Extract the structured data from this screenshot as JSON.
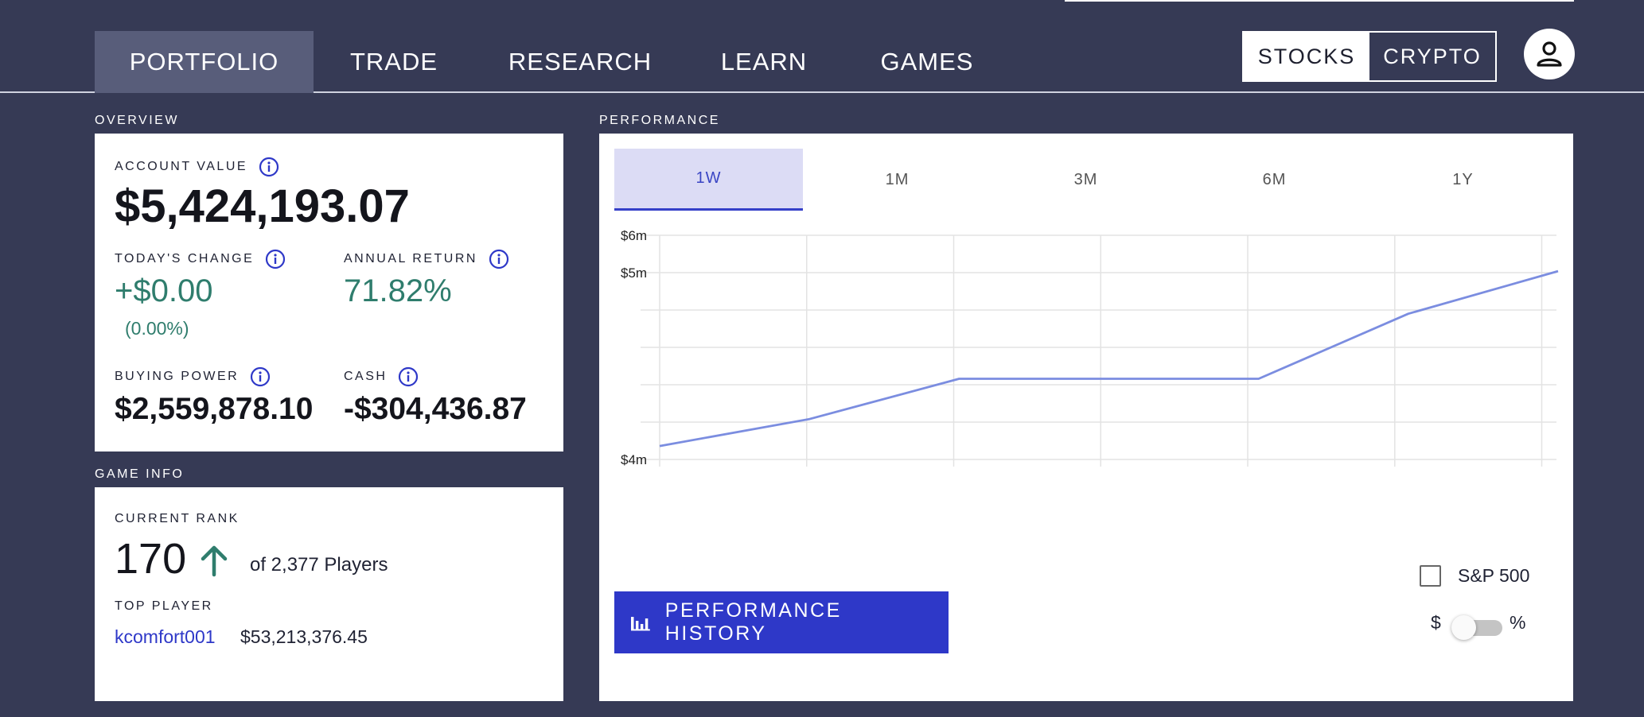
{
  "nav": {
    "tabs": [
      {
        "label": "PORTFOLIO",
        "active": true
      },
      {
        "label": "TRADE"
      },
      {
        "label": "RESEARCH"
      },
      {
        "label": "LEARN"
      },
      {
        "label": "GAMES"
      }
    ],
    "toggle": {
      "stocks": "STOCKS",
      "crypto": "CRYPTO",
      "selected": "STOCKS"
    },
    "avatar_icon": "user-icon"
  },
  "overview": {
    "section_label": "OVERVIEW",
    "account_value_label": "ACCOUNT VALUE",
    "account_value": "$5,424,193.07",
    "todays_change_label": "TODAY'S CHANGE",
    "todays_change": "+$0.00",
    "todays_change_pct": "(0.00%)",
    "annual_return_label": "ANNUAL RETURN",
    "annual_return": "71.82%",
    "buying_power_label": "BUYING POWER",
    "buying_power": "$2,559,878.10",
    "cash_label": "CASH",
    "cash": "-$304,436.87"
  },
  "game_info": {
    "section_label": "GAME INFO",
    "current_rank_label": "CURRENT RANK",
    "rank": "170",
    "rank_trend_icon": "arrow-up-icon",
    "players_text": "of 2,377 Players",
    "top_player_label": "TOP PLAYER",
    "top_player_name": "kcomfort001",
    "top_player_value": "$53,213,376.45"
  },
  "performance": {
    "section_label": "PERFORMANCE",
    "timeframes": [
      "1W",
      "1M",
      "3M",
      "6M",
      "1Y"
    ],
    "selected_timeframe": "1W",
    "history_button": "PERFORMANCE HISTORY",
    "sp500_label": "S&P 500",
    "sp500_checked": false,
    "unit_dollar": "$",
    "unit_percent": "%",
    "unit_selected": "$"
  },
  "colors": {
    "background": "#363a55",
    "accent": "#2e38c8",
    "positive": "#2f7d6d",
    "line": "#7b8de0"
  },
  "chart_data": {
    "type": "line",
    "y_tick_labels": [
      "$6m",
      "$5m",
      "$4m"
    ],
    "ylim": [
      4000000,
      6000000
    ],
    "x": [
      0,
      1,
      2,
      3,
      4,
      5,
      6
    ],
    "values": [
      4120000,
      4360000,
      4720000,
      4720000,
      4720000,
      5300000,
      5680000
    ],
    "grid": true
  }
}
